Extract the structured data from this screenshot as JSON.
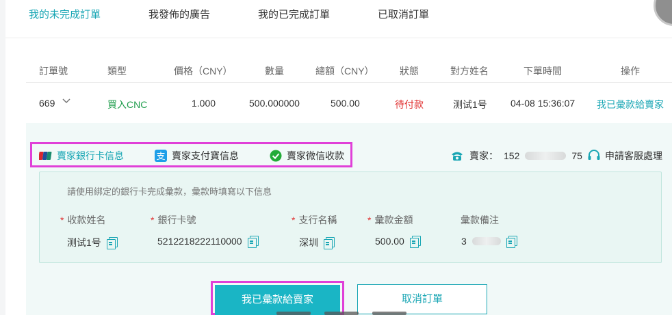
{
  "tabs": [
    {
      "label": "我的未完成訂單",
      "active": true
    },
    {
      "label": "我發佈的廣告",
      "active": false
    },
    {
      "label": "我的已完成訂單",
      "active": false
    },
    {
      "label": "已取消訂單",
      "active": false
    }
  ],
  "table": {
    "headers": [
      "訂單號",
      "類型",
      "價格（CNY）",
      "數量",
      "總額（CNY）",
      "狀態",
      "對方姓名",
      "下單時間",
      "操作"
    ],
    "row": {
      "order_no": "669",
      "type": "買入CNC",
      "price": "1.000",
      "quantity": "500.000000",
      "total": "500.00",
      "status": "待付款",
      "counterparty": "测试1号",
      "time": "04-08 15:36:07",
      "action": "我已彙款給賣家"
    }
  },
  "payment_tabs": [
    {
      "label": "賣家銀行卡信息",
      "icon": "unionpay-icon",
      "active": true
    },
    {
      "label": "賣家支付寶信息",
      "icon": "alipay-icon",
      "active": false
    },
    {
      "label": "賣家微信收款",
      "icon": "wechat-icon",
      "active": false
    }
  ],
  "seller": {
    "label": "賣家：",
    "phone_visible_start": "152",
    "phone_visible_end": "75"
  },
  "support_label": "申請客服處理",
  "bank_info": {
    "instruction": "請使用綁定的銀行卡完成彙款，彙款時填寫以下信息",
    "required_mark": "*",
    "fields": [
      {
        "label": "收款姓名",
        "value": "测试1号",
        "required": true
      },
      {
        "label": "銀行卡號",
        "value": "5212218222110000",
        "required": true
      },
      {
        "label": "支行名稱",
        "value": "深圳",
        "required": true
      },
      {
        "label": "彙款金額",
        "value": "500.00",
        "required": true
      },
      {
        "label": "彙款備注",
        "value": "3",
        "required": false
      }
    ]
  },
  "buttons": {
    "confirm": "我已彙款給賣家",
    "cancel": "取消訂單"
  },
  "colors": {
    "accent": "#19a6b4",
    "buy_green": "#1f9d4c",
    "status_red": "#e03030",
    "highlight_magenta": "#e040d8"
  }
}
